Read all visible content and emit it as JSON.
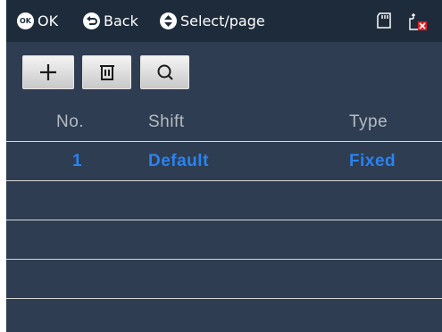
{
  "hints": {
    "ok_icon": "OK",
    "ok_label": "OK",
    "back_label": "Back",
    "select_label": "Select/page"
  },
  "status_icons": [
    "sd-card-icon",
    "network-disconnected-icon"
  ],
  "toolbar": {
    "buttons": [
      "add-icon",
      "delete-icon",
      "search-icon"
    ]
  },
  "table": {
    "columns": [
      "No.",
      "Shift",
      "Type"
    ],
    "rows": [
      {
        "no": "1",
        "shift": "Default",
        "type": "Fixed"
      }
    ]
  },
  "colors": {
    "topbar": "#1e2b3b",
    "panel": "#2e3d51",
    "header_text": "#b5bbc2",
    "selected_text": "#2a83f2",
    "row_line": "#d8d8d8"
  }
}
